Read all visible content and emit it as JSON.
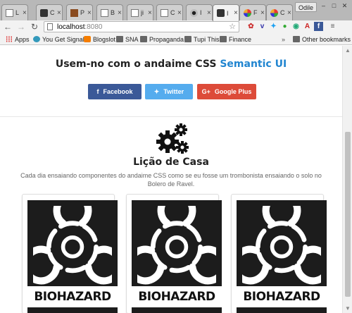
{
  "browser": {
    "tabs": [
      {
        "label": "L",
        "icon": "document-icon"
      },
      {
        "label": "C",
        "icon": "vector-icon"
      },
      {
        "label": "P",
        "icon": "star-icon"
      },
      {
        "label": "B",
        "icon": "document-icon"
      },
      {
        "label": "ji",
        "icon": "document-icon"
      },
      {
        "label": "C",
        "icon": "document-icon"
      },
      {
        "label": "I",
        "icon": "biohazard-icon"
      },
      {
        "label": "I",
        "icon": "stackoverflow-icon",
        "active": true
      },
      {
        "label": "F",
        "icon": "colorful-icon"
      },
      {
        "label": "C",
        "icon": "colorful-icon"
      }
    ],
    "close_glyph": "×",
    "user_badge": "Odile",
    "url_host": "localhost",
    "url_port": ":8080",
    "bookmarks": [
      {
        "label": "Apps",
        "icon": "apps-icon"
      },
      {
        "label": "You Get Signal",
        "icon": "globe-icon"
      },
      {
        "label": "Blogslot",
        "icon": "blogger-icon"
      },
      {
        "label": "SNA",
        "icon": "folder-icon"
      },
      {
        "label": "Propaganda",
        "icon": "folder-icon"
      },
      {
        "label": "Tupi This",
        "icon": "folder-icon"
      },
      {
        "label": "Finance",
        "icon": "folder-icon"
      }
    ],
    "bookmarks_overflow": "»",
    "other_bookmarks": "Other bookmarks"
  },
  "page": {
    "heading_prefix": "Usem-no com o andaime CSS ",
    "heading_accent": "Semantic UI",
    "social": {
      "facebook": "Facebook",
      "twitter": "Twitter",
      "google_plus": "Google Plus"
    },
    "lesson_title": "Lição de Casa",
    "lesson_desc": "Cada dia ensaiando componentes do andaime CSS como se eu fosse um trombonista ensaiando o solo no Bolero de Ravel.",
    "cards": [
      {
        "label": "BIOHAZARD"
      },
      {
        "label": "BIOHAZARD"
      },
      {
        "label": "BIOHAZARD"
      }
    ]
  },
  "colors": {
    "accent": "#2185d0",
    "facebook": "#3b5998",
    "twitter": "#55acee",
    "google_plus": "#dd4b39"
  }
}
